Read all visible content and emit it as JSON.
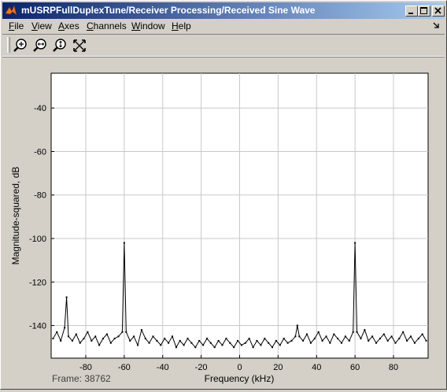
{
  "window": {
    "title": "mUSRPFullDuplexTune/Receiver Processing/Received Sine Wave",
    "controls": [
      "minimize-icon",
      "maximize-icon",
      "close-icon"
    ]
  },
  "menu": {
    "items": [
      {
        "label": "File",
        "u": "F",
        "rest": "ile"
      },
      {
        "label": "View",
        "u": "V",
        "rest": "iew"
      },
      {
        "label": "Axes",
        "u": "A",
        "rest": "xes"
      },
      {
        "label": "Channels",
        "u": "C",
        "rest": "hannels"
      },
      {
        "label": "Window",
        "u": "W",
        "rest": "indow"
      },
      {
        "label": "Help",
        "u": "H",
        "rest": "elp"
      }
    ],
    "right_icon": "dock-arrow-icon"
  },
  "toolbar": {
    "tools": [
      "zoom-in-icon",
      "zoom-x-icon",
      "zoom-y-icon",
      "autoscale-icon"
    ]
  },
  "status": {
    "frame": "Frame: 38762"
  },
  "colors": {
    "title_start": "#0a246a",
    "title_end": "#a6caf0",
    "plot_bg": "#ffffff",
    "grid": "#c8c8c8",
    "trace": "#000000"
  },
  "chart_data": {
    "type": "line",
    "title": "",
    "xlabel": "Frequency (kHz)",
    "ylabel": "Magnitude-squared, dB",
    "xlim": [
      -98,
      98
    ],
    "ylim": [
      -155,
      -24
    ],
    "xticks": [
      -80,
      -60,
      -40,
      -20,
      0,
      20,
      40,
      60,
      80
    ],
    "yticks": [
      -40,
      -60,
      -80,
      -100,
      -120,
      -140
    ],
    "grid": true,
    "series": [
      {
        "x": [
          -97,
          -95,
          -93,
          -91,
          -90,
          -89,
          -87,
          -85,
          -83,
          -81,
          -79,
          -77,
          -75,
          -73,
          -71,
          -69,
          -67,
          -65,
          -63,
          -61,
          -60,
          -59,
          -57,
          -55,
          -53,
          -51,
          -49,
          -47,
          -45,
          -43,
          -41,
          -39,
          -37,
          -35,
          -33,
          -31,
          -29,
          -27,
          -25,
          -23,
          -21,
          -19,
          -17,
          -15,
          -13,
          -11,
          -9,
          -7,
          -5,
          -3,
          -1,
          1,
          3,
          5,
          7,
          9,
          11,
          13,
          15,
          17,
          19,
          21,
          23,
          25,
          27,
          29,
          30,
          31,
          33,
          35,
          37,
          39,
          41,
          43,
          45,
          47,
          49,
          51,
          53,
          55,
          57,
          59,
          60,
          61,
          63,
          65,
          67,
          69,
          71,
          73,
          75,
          77,
          79,
          81,
          83,
          85,
          87,
          89,
          91,
          93,
          95,
          97
        ],
        "y": [
          -146,
          -143,
          -147,
          -141,
          -127,
          -145,
          -147,
          -144,
          -148,
          -146,
          -143,
          -147,
          -145,
          -149,
          -146,
          -144,
          -148,
          -146,
          -145,
          -143,
          -102,
          -143,
          -147,
          -145,
          -149,
          -142,
          -146,
          -148,
          -145,
          -147,
          -149,
          -146,
          -148,
          -145,
          -150,
          -147,
          -149,
          -146,
          -148,
          -150,
          -147,
          -149,
          -146,
          -148,
          -150,
          -147,
          -149,
          -146,
          -148,
          -150,
          -147,
          -149,
          -148,
          -146,
          -150,
          -147,
          -149,
          -146,
          -148,
          -150,
          -147,
          -149,
          -146,
          -148,
          -147,
          -145,
          -140,
          -145,
          -147,
          -144,
          -148,
          -146,
          -143,
          -147,
          -145,
          -148,
          -144,
          -146,
          -148,
          -145,
          -147,
          -143,
          -102,
          -143,
          -146,
          -142,
          -147,
          -145,
          -148,
          -146,
          -144,
          -147,
          -145,
          -148,
          -146,
          -143,
          -147,
          -145,
          -148,
          -146,
          -144,
          -147
        ]
      }
    ]
  }
}
